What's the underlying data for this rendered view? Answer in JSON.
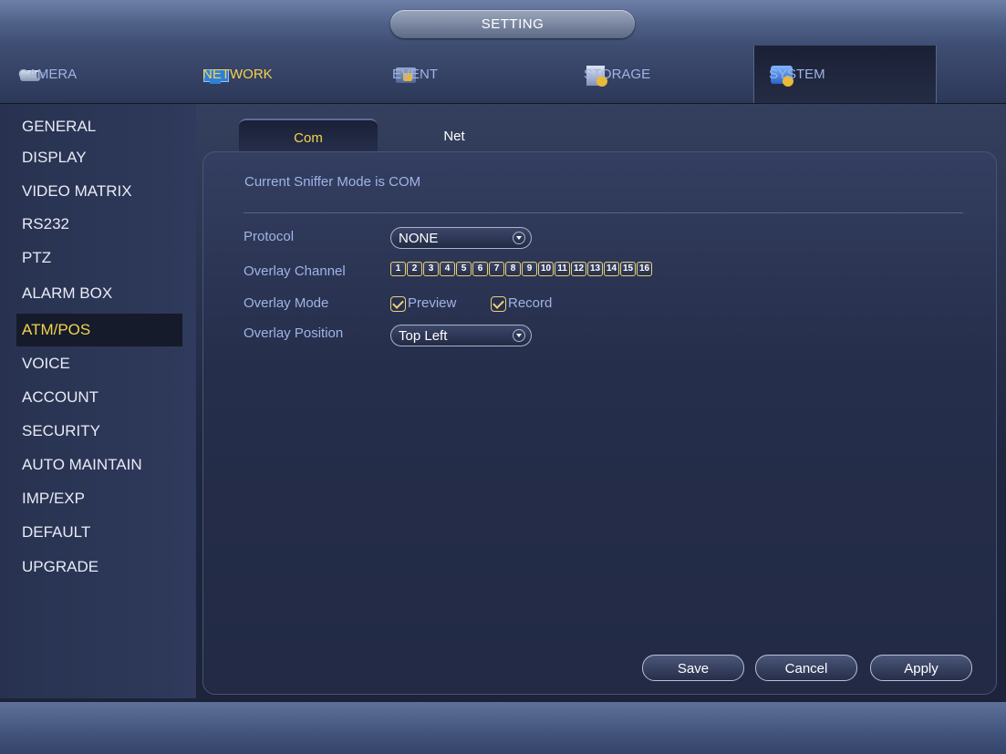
{
  "title": "SETTING",
  "tabs": [
    {
      "label": "CAMERA",
      "icon": "camera-icon"
    },
    {
      "label": "NETWORK",
      "icon": "network-icon"
    },
    {
      "label": "EVENT",
      "icon": "event-icon"
    },
    {
      "label": "STORAGE",
      "icon": "storage-icon"
    },
    {
      "label": "SYSTEM",
      "icon": "system-icon",
      "active": true
    }
  ],
  "sidebar": {
    "items": [
      {
        "label": "GENERAL"
      },
      {
        "label": "DISPLAY"
      },
      {
        "label": "VIDEO MATRIX"
      },
      {
        "label": "RS232"
      },
      {
        "label": "PTZ"
      },
      {
        "label": "ALARM BOX"
      },
      {
        "label": "ATM/POS",
        "selected": true
      },
      {
        "label": "VOICE"
      },
      {
        "label": "ACCOUNT"
      },
      {
        "label": "SECURITY"
      },
      {
        "label": "AUTO MAINTAIN"
      },
      {
        "label": "IMP/EXP"
      },
      {
        "label": "DEFAULT"
      },
      {
        "label": "UPGRADE"
      }
    ]
  },
  "subtabs": [
    {
      "label": "Com",
      "active": true
    },
    {
      "label": "Net"
    }
  ],
  "main": {
    "sniffer_text": "Current Sniffer Mode is COM",
    "protocol_label": "Protocol",
    "protocol_value": "NONE",
    "overlay_channel_label": "Overlay Channel",
    "channels": [
      "1",
      "2",
      "3",
      "4",
      "5",
      "6",
      "7",
      "8",
      "9",
      "10",
      "11",
      "12",
      "13",
      "14",
      "15",
      "16"
    ],
    "overlay_mode_label": "Overlay Mode",
    "overlay_mode_preview": "Preview",
    "overlay_mode_record": "Record",
    "overlay_position_label": "Overlay Position",
    "overlay_position_value": "Top Left"
  },
  "buttons": {
    "save": "Save",
    "cancel": "Cancel",
    "apply": "Apply"
  },
  "colors": {
    "accent": "#f3d34c",
    "label": "#9fb4e6"
  }
}
